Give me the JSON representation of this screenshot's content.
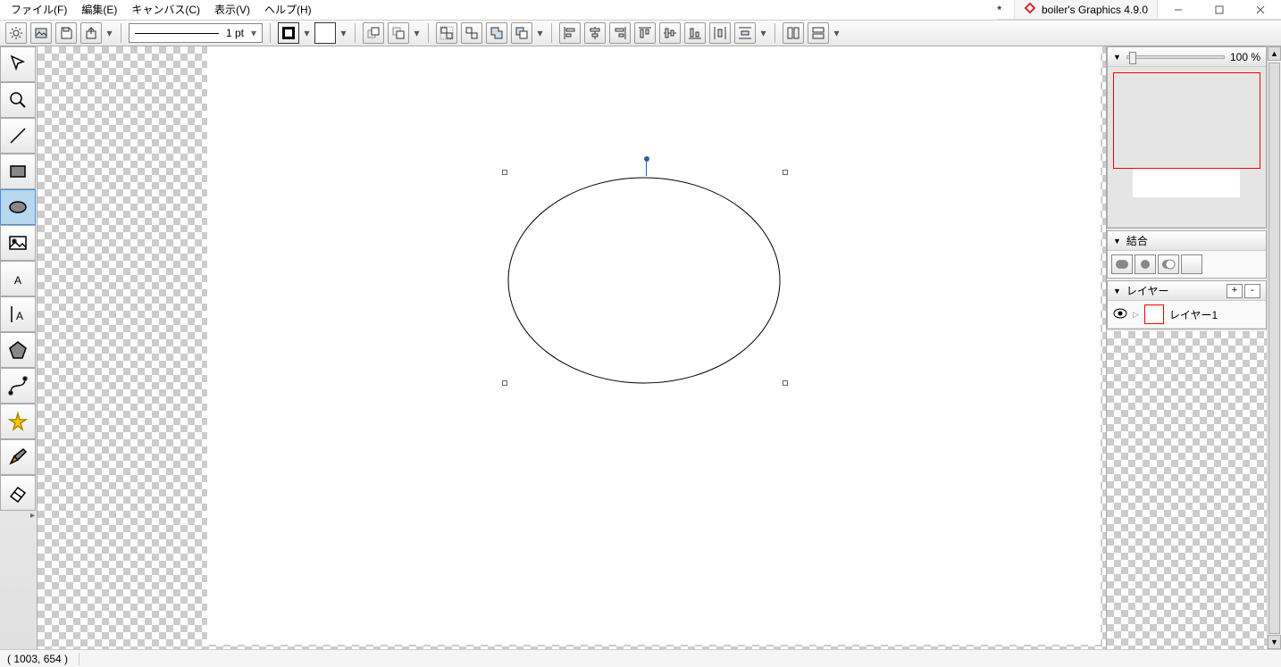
{
  "app": {
    "title": "boiler's Graphics 4.9.0",
    "dirty_marker": "*"
  },
  "menu": {
    "file": "ファイル(F)",
    "edit": "編集(E)",
    "canvas": "キャンバス(C)",
    "view": "表示(V)",
    "help": "ヘルプ(H)"
  },
  "toolbar": {
    "stroke_width_label": "1 pt"
  },
  "zoom": {
    "percent": "100 %"
  },
  "panels": {
    "combine_title": "結合",
    "layers_title": "レイヤー",
    "layer1_name": "レイヤー1",
    "add_label": "+",
    "remove_label": "-"
  },
  "status": {
    "coords": "( 1003,    654 )"
  },
  "tools": {
    "select": "select",
    "zoom": "zoom",
    "line": "line",
    "rect": "rect",
    "ellipse": "ellipse",
    "image": "image",
    "text": "text",
    "vtext": "vtext",
    "polygon": "polygon",
    "bezier": "bezier",
    "star": "star",
    "brush": "brush",
    "eraser": "eraser"
  }
}
